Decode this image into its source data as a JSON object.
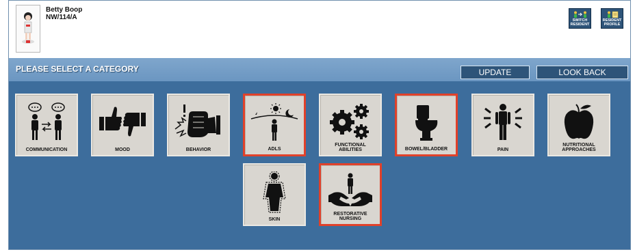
{
  "resident": {
    "name": "Betty Boop",
    "id": "NW/114/A"
  },
  "header_buttons": [
    {
      "label_1": "SWITCH",
      "label_2": "RESIDENT",
      "icon": "switch-resident-icon"
    },
    {
      "label_1": "RESIDENT",
      "label_2": "PROFILE",
      "icon": "resident-profile-icon"
    }
  ],
  "bar": {
    "title": "PLEASE SELECT A CATEGORY",
    "update_label": "UPDATE",
    "look_back_label": "LOOK BACK"
  },
  "categories": [
    {
      "label": "COMMUNICATION",
      "icon": "communication-icon",
      "selected": false
    },
    {
      "label": "MOOD",
      "icon": "thumbs-up-down-icon",
      "selected": false
    },
    {
      "label": "BEHAVIOR",
      "icon": "fist-icon",
      "selected": false
    },
    {
      "label": "ADLS",
      "icon": "day-night-person-icon",
      "selected": true
    },
    {
      "label_1": "FUNCTIONAL",
      "label_2": "ABILITIES",
      "icon": "gears-icon",
      "selected": false
    },
    {
      "label": "BOWEL/BLADDER",
      "icon": "toilet-icon",
      "selected": true
    },
    {
      "label": "PAIN",
      "icon": "pain-person-icon",
      "selected": false
    },
    {
      "label_1": "NUTRITIONAL",
      "label_2": "APPROACHES",
      "icon": "apple-icon",
      "selected": false
    },
    {
      "label": "SKIN",
      "icon": "skin-outline-icon",
      "selected": false
    },
    {
      "label_1": "RESTORATIVE",
      "label_2": "NURSING",
      "icon": "hands-person-icon",
      "selected": true
    }
  ],
  "colors": {
    "background": "#3d6d9c",
    "bar": "#7fa6cc",
    "tile": "#d9d6d0",
    "selected_border": "#e1412a",
    "button": "#2e5479"
  }
}
